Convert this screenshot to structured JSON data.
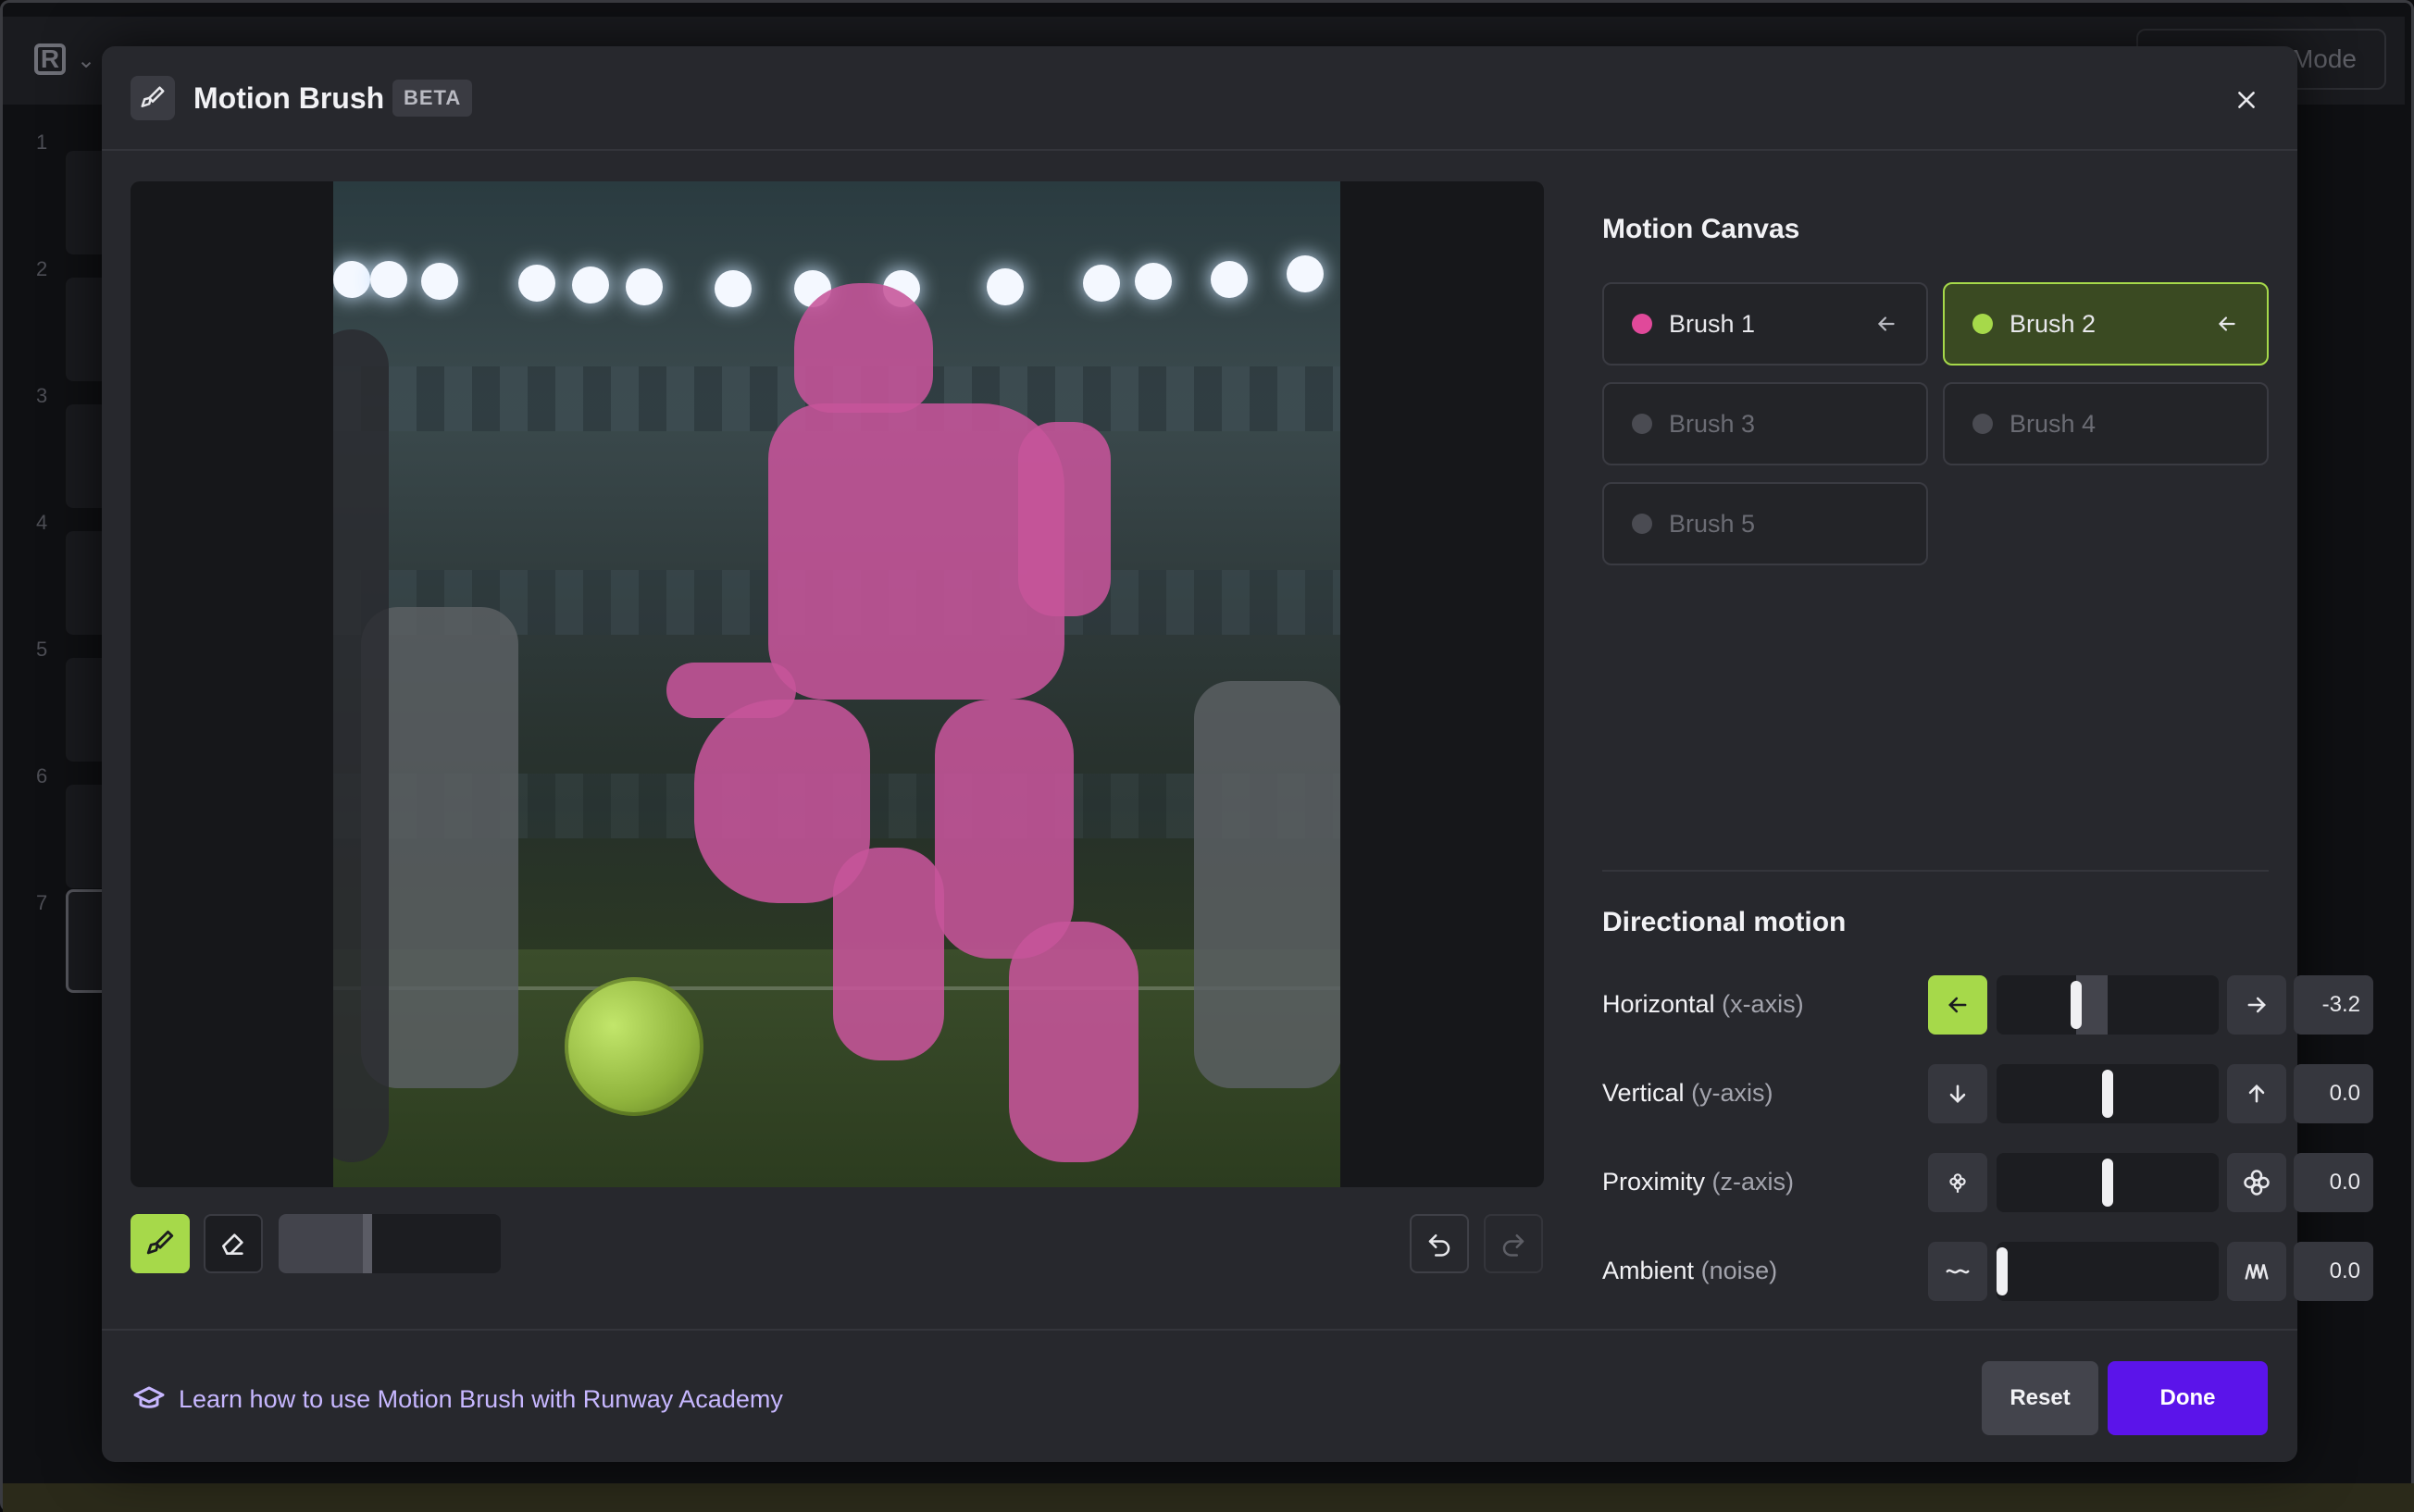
{
  "background_app": {
    "mode_label": "Mode",
    "sidebar_numbers": [
      "1",
      "2",
      "3",
      "4",
      "5",
      "6",
      "7"
    ]
  },
  "modal": {
    "title": "Motion Brush",
    "badge": "BETA"
  },
  "motion_canvas": {
    "title": "Motion Canvas",
    "brushes": [
      {
        "label": "Brush 1",
        "color": "#e0499a",
        "state": "used"
      },
      {
        "label": "Brush 2",
        "color": "#a6d94a",
        "state": "selected"
      },
      {
        "label": "Brush 3",
        "color": "#4a4b52",
        "state": "disabled"
      },
      {
        "label": "Brush 4",
        "color": "#4a4b52",
        "state": "disabled"
      },
      {
        "label": "Brush 5",
        "color": "#4a4b52",
        "state": "disabled"
      }
    ]
  },
  "toolbar": {
    "brush_size_fraction": 0.4
  },
  "directional_motion": {
    "title": "Directional motion",
    "rows": [
      {
        "label": "Horizontal",
        "axis": "(x-axis)",
        "value": "-3.2",
        "left_icon": "arrow-left-icon",
        "right_icon": "arrow-right-icon"
      },
      {
        "label": "Vertical",
        "axis": "(y-axis)",
        "value": "0.0",
        "left_icon": "arrow-down-icon",
        "right_icon": "arrow-up-icon"
      },
      {
        "label": "Proximity",
        "axis": "(z-axis)",
        "value": "0.0",
        "left_icon": "flower-small-icon",
        "right_icon": "flower-large-icon"
      },
      {
        "label": "Ambient",
        "axis": "(noise)",
        "value": "0.0",
        "left_icon": "wave-low-icon",
        "right_icon": "wave-high-icon"
      }
    ]
  },
  "footer": {
    "academy_link": "Learn how to use Motion Brush with Runway Academy",
    "reset_label": "Reset",
    "done_label": "Done"
  },
  "colors": {
    "accent_green": "#a6d94a",
    "accent_purple": "#5b14ea",
    "mask_pink": "#c6549a"
  }
}
